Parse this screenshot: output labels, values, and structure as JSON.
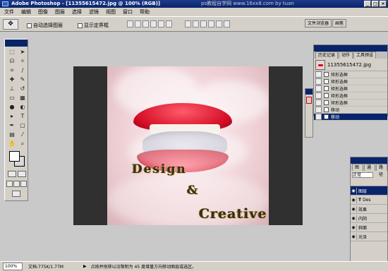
{
  "titlebar": {
    "title": "Adobe Photoshop - [11355615472.jpg @ 100% (RGB)]",
    "overlay_text": "ps教程自学网  www.16xx8.com  by tuan"
  },
  "menubar": {
    "items": [
      "文件",
      "编辑",
      "图像",
      "图层",
      "选择",
      "滤镜",
      "视图",
      "窗口",
      "帮助"
    ]
  },
  "toolbar": {
    "auto_select": "自动选择图层",
    "show_bounds": "显示定界框"
  },
  "palette_well": {
    "tabs": [
      "文件浏览器",
      "画笔"
    ]
  },
  "canvas": {
    "text_design": "Design",
    "text_and": "&",
    "text_creative": "Creative"
  },
  "history": {
    "tabs": [
      "历史记录",
      "动作",
      "工具预设"
    ],
    "snapshot": "11355615472.jpg",
    "items": [
      "矩形选框",
      "矩形选框",
      "矩形选框",
      "矩形选框",
      "矩形选框",
      "移动",
      "移动"
    ],
    "active_index": 6
  },
  "layers": {
    "tabs": [
      "图层",
      "通道",
      "路径"
    ],
    "blend_mode": "正常",
    "rows": [
      {
        "label": "图层"
      },
      {
        "label": "Des"
      },
      {
        "label": "效果"
      },
      {
        "label": "内阴"
      },
      {
        "label": "斜面"
      },
      {
        "label": "光泽"
      }
    ]
  },
  "status": {
    "zoom": "100%",
    "docsize": "文档:775K/1.77M",
    "hint": "点按并拖移以沿限制为 45 度增量方向移动图层或选区。"
  },
  "colors": {
    "title_bg": "#0a246a",
    "lip_red": "#d40c24",
    "panel_bg": "#d4d0c8"
  }
}
